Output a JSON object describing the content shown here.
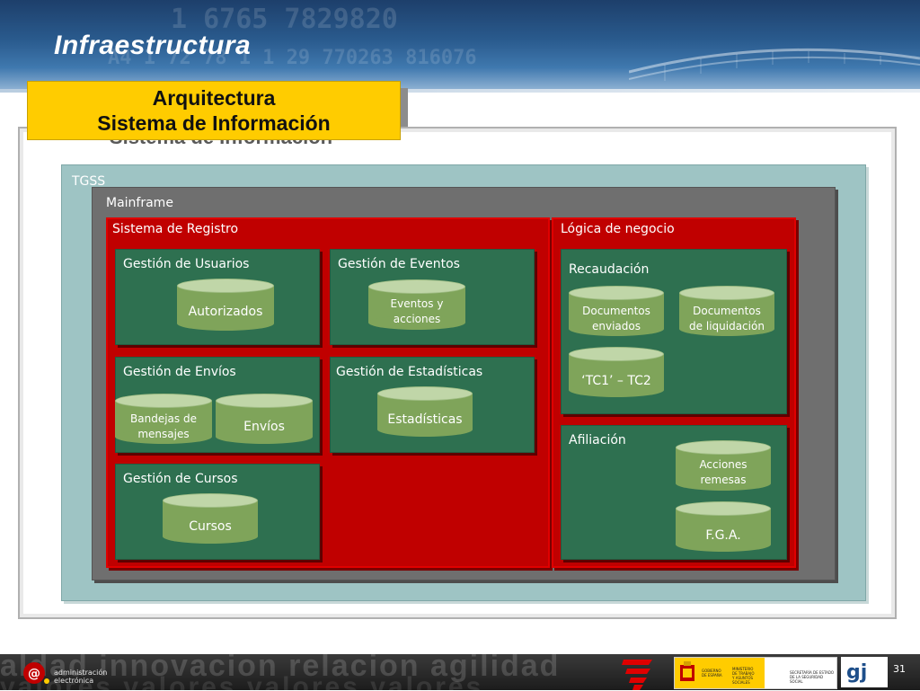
{
  "header": {
    "title": "Infraestructura",
    "bg_numbers": [
      "1 6765 7829820",
      "A4 1 72 78 1 1 29 770263 816076"
    ]
  },
  "label_box": {
    "line1": "Arquitectura",
    "line2": "Sistema de Información"
  },
  "diagram": {
    "tgss": "TGSS",
    "mainframe": "Mainframe",
    "sistema_registro": {
      "label": "Sistema de Registro",
      "usuarios": {
        "label": "Gestión de Usuarios",
        "db": "Autorizados"
      },
      "eventos": {
        "label": "Gestión de Eventos",
        "db": "Eventos y\nacciones"
      },
      "envios": {
        "label": "Gestión de Envíos",
        "db1": "Bandejas de\nmensajes",
        "db2": "Envíos"
      },
      "estadisticas": {
        "label": "Gestión de Estadísticas",
        "db": "Estadísticas"
      },
      "cursos": {
        "label": "Gestión de Cursos",
        "db": "Cursos"
      }
    },
    "logica": {
      "label": "Lógica de negocio",
      "recaudacion": {
        "label": "Recaudación",
        "db1": "Documentos\nenviados",
        "db2": "Documentos\nde liquidación",
        "db3": "‘TC1’ – TC2"
      },
      "afiliacion": {
        "label": "Afiliación",
        "db1": "Acciones\nremesas",
        "db2": "F.G.A."
      }
    }
  },
  "footer": {
    "bg_words_1": "aldad   innovacion     relacion    agilidad",
    "bg_words_2": "valores   valores    valores   valores",
    "ae_logo_text": "administración\nelectrónica",
    "gov_text_1": "GOBIERNO\nDE ESPAÑA",
    "gov_text_2": "MINISTERIO\nDE TRABAJO\nY ASUNTOS SOCIALES",
    "gov_text_3": "SECRETARÍA DE ESTADO\nDE LA SEGURIDAD SOCIAL",
    "page_number": "31"
  },
  "colors": {
    "header_blue": "#2a5b8e",
    "label_yellow": "#ffcc00",
    "tgss_teal": "#9ec4c4",
    "mainframe_gray": "#6f6f6f",
    "red": "#c00000",
    "green": "#2e7050",
    "db_green": "#7fa45a"
  },
  "icons": {
    "ae_logo": "administracion-electronica-logo",
    "gov_logo": "gobierno-espana-logo",
    "gj_logo": "gj-logo"
  }
}
